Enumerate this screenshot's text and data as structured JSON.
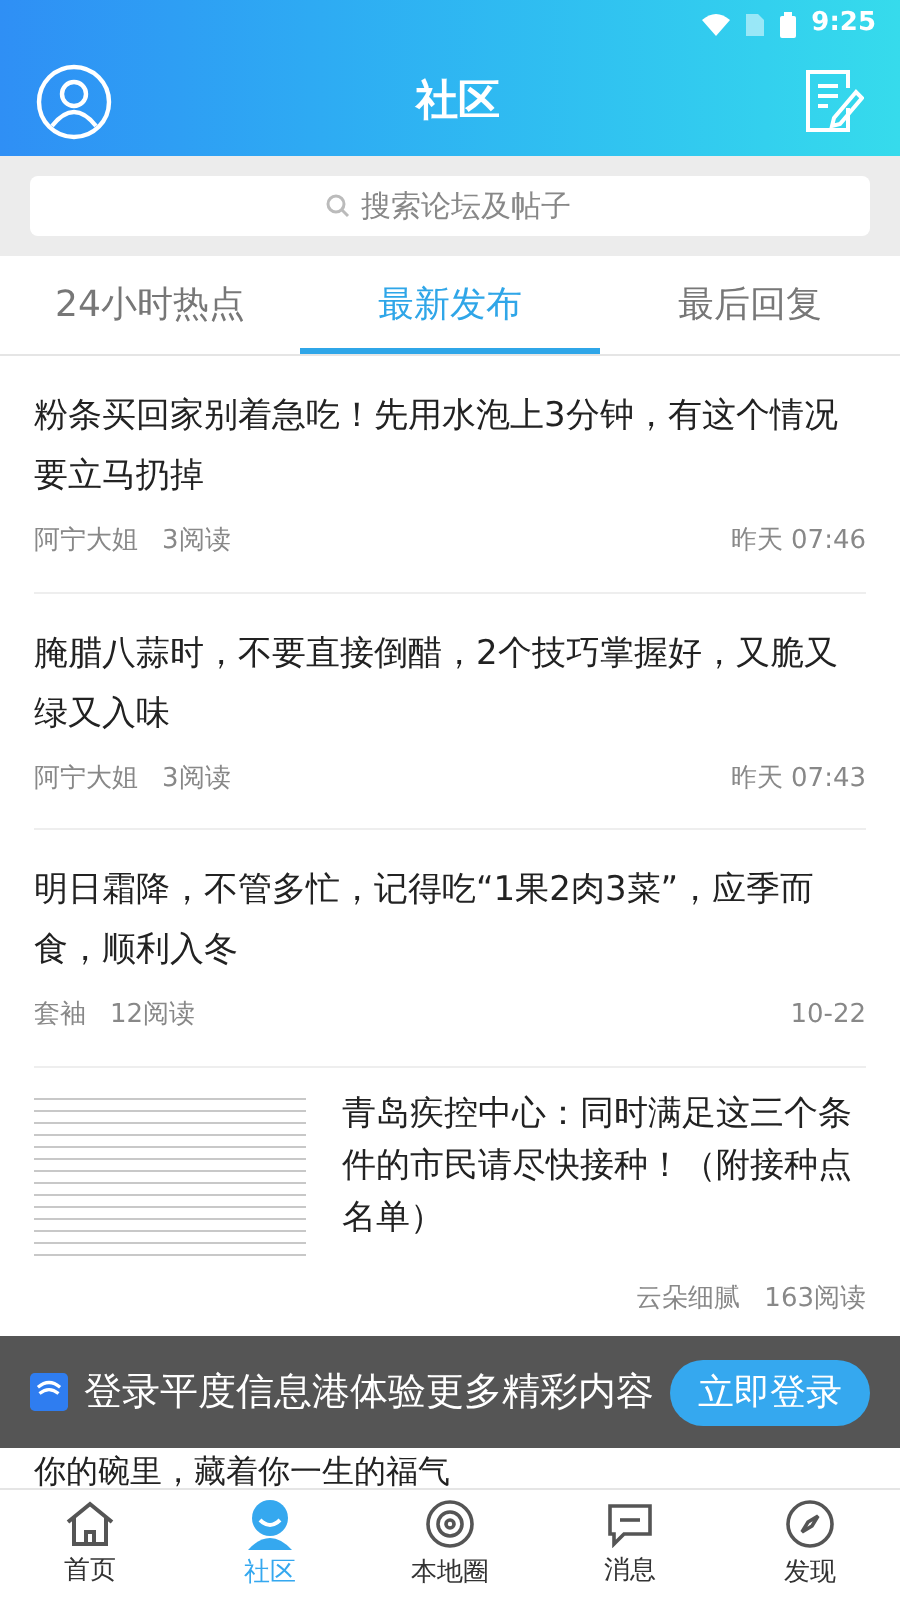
{
  "status_bar": {
    "time": "9:25"
  },
  "header": {
    "title": "社区"
  },
  "search": {
    "placeholder": "搜索论坛及帖子"
  },
  "tabs": [
    {
      "label": "24小时热点",
      "selected": false
    },
    {
      "label": "最新发布",
      "selected": true
    },
    {
      "label": "最后回复",
      "selected": false
    }
  ],
  "posts": [
    {
      "kind": "text",
      "title": "粉条买回家别着急吃！先用水泡上3分钟，有这个情况要立马扔掉",
      "author": "阿宁大姐",
      "reads": "3阅读",
      "time": "昨天 07:46"
    },
    {
      "kind": "text",
      "title": "腌腊八蒜时，不要直接倒醋，2个技巧掌握好，又脆又绿又入味",
      "author": "阿宁大姐",
      "reads": "3阅读",
      "time": "昨天 07:43"
    },
    {
      "kind": "text",
      "title": "明日霜降，不管多忙，记得吃“1果2肉3菜”，应季而食，顺利入冬",
      "author": "套袖",
      "reads": "12阅读",
      "time": "10-22"
    },
    {
      "kind": "image",
      "title": "青岛疾控中心：同时满足这三个条件的市民请尽快接种！（附接种点名单）",
      "author": "云朵细腻",
      "reads": "163阅读"
    }
  ],
  "login_banner": {
    "text": "登录平度信息港体验更多精彩内容",
    "button": "立即登录"
  },
  "partial_post_title": "你的碗里，藏着你一生的福气",
  "bottom_nav": [
    {
      "label": "首页",
      "kind": "home",
      "selected": false
    },
    {
      "label": "社区",
      "kind": "community",
      "selected": true
    },
    {
      "label": "本地圈",
      "kind": "local",
      "selected": false
    },
    {
      "label": "消息",
      "kind": "chat",
      "selected": false
    },
    {
      "label": "发现",
      "kind": "discover",
      "selected": false
    }
  ]
}
